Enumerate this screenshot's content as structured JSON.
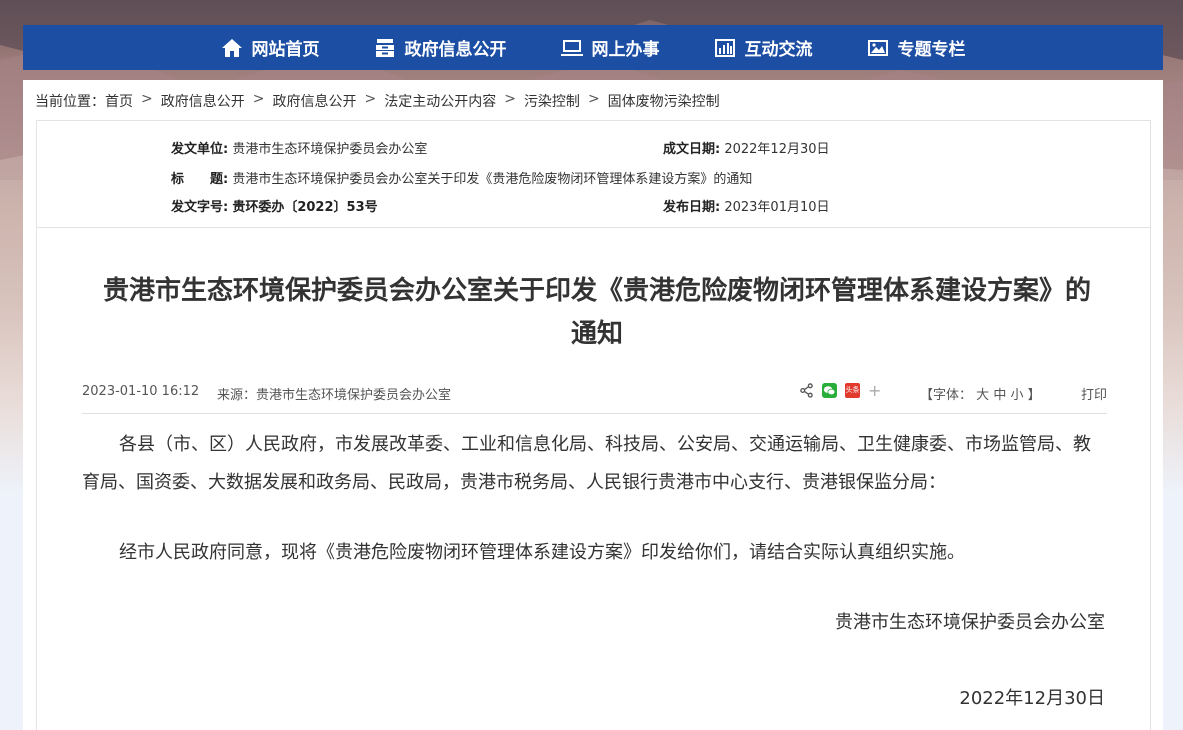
{
  "nav": {
    "items": [
      {
        "label": "网站首页",
        "icon": "home-icon"
      },
      {
        "label": "政府信息公开",
        "icon": "archive-icon"
      },
      {
        "label": "网上办事",
        "icon": "computer-icon"
      },
      {
        "label": "互动交流",
        "icon": "bar-chart-icon"
      },
      {
        "label": "专题专栏",
        "icon": "image-icon"
      }
    ]
  },
  "breadcrumb": {
    "prefix": "当前位置：",
    "items": [
      "首页",
      "政府信息公开",
      "政府信息公开",
      "法定主动公开内容",
      "污染控制",
      "固体废物污染控制"
    ],
    "separator": ">"
  },
  "meta": {
    "issuer_label": "发文单位:",
    "issuer": "贵港市生态环境保护委员会办公室",
    "created_label": "成文日期:",
    "created": "2022年12月30日",
    "title_label": "标　　题:",
    "title": "贵港市生态环境保护委员会办公室关于印发《贵港危险废物闭环管理体系建设方案》的通知",
    "docno_label": "发文字号:",
    "docno": "贵环委办〔2022〕53号",
    "published_label": "发布日期:",
    "published": "2023年01月10日"
  },
  "article": {
    "title": "贵港市生态环境保护委员会办公室关于印发《贵港危险废物闭环管理体系建设方案》的通知",
    "datetime": "2023-01-10 16:12",
    "source": "来源：贵港市生态环境保护委员会办公室",
    "font_label": "【字体：",
    "font_large": "大",
    "font_medium": "中",
    "font_small": "小",
    "font_end": "】",
    "print": "打印",
    "paragraph1": "各县（市、区）人民政府，市发展改革委、工业和信息化局、科技局、公安局、交通运输局、卫生健康委、市场监管局、教育局、国资委、大数据发展和政务局、民政局，贵港市税务局、人民银行贵港市中心支行、贵港银保监分局：",
    "paragraph2": "经市人民政府同意，现将《贵港危险废物闭环管理体系建设方案》印发给你们，请结合实际认真组织实施。",
    "signature": "贵港市生态环境保护委员会办公室",
    "sign_date": "2022年12月30日"
  },
  "share": {
    "icons": [
      "share-icon",
      "wechat-icon",
      "toutiao-icon",
      "plus-icon"
    ],
    "toutiao_text": "头条",
    "plus_text": "+"
  },
  "colors": {
    "nav_bg": "#1c4ea4",
    "wechat": "#2aae3a",
    "toutiao": "#e23b2e"
  }
}
